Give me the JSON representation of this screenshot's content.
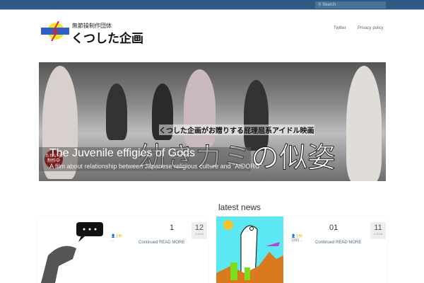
{
  "header": {
    "search_placeholder": "Search",
    "subtitle": "無節操制作団体",
    "site_title": "くつした企画",
    "nav": [
      "Twitter",
      "Privacy policy"
    ]
  },
  "hero": {
    "tagline": "くつした企画がお贈りする屁理屈系アイドル映画",
    "big_title": "幼きカミの似姿",
    "title": "The Juvenile effigies of Gods",
    "description": "A film about relationship between Japanese religious culture and \"AIDORU\"",
    "badge": "ただいま制作中"
  },
  "section": {
    "heading": "latest news"
  },
  "posts": [
    {
      "title": "1",
      "day": "12",
      "month_year": "3 2016",
      "meta": "👤 | 📁",
      "excerpt": "...",
      "read_more": "Continued READ MORE"
    },
    {
      "title": "01",
      "day": "11",
      "month_year": "4 2016",
      "meta": "👤 | 📁",
      "excerpt": "1999 ...",
      "read_more": "Continued READ MORE"
    }
  ]
}
